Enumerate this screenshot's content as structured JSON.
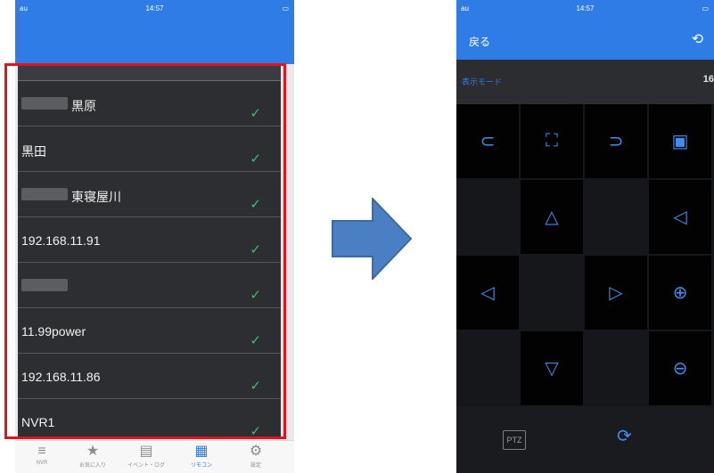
{
  "status_bar": {
    "carrier": "au",
    "time": "14:57"
  },
  "device_list": {
    "items": [
      {
        "name": "黒原",
        "blurred_prefix": true
      },
      {
        "name": "黒田",
        "blurred_prefix": false
      },
      {
        "name": "東寝屋川",
        "blurred_prefix": true
      },
      {
        "name": "192.168.11.91",
        "blurred_prefix": false
      },
      {
        "name": "",
        "blurred_prefix": true
      },
      {
        "name": "11.99power",
        "blurred_prefix": false
      },
      {
        "name": "192.168.11.86",
        "blurred_prefix": false
      },
      {
        "name": "NVR1",
        "blurred_prefix": false
      }
    ]
  },
  "tab_bar": {
    "tabs": [
      {
        "label": "NVR",
        "icon": "menu-icon"
      },
      {
        "label": "お気に入り",
        "icon": "star-icon"
      },
      {
        "label": "イベント・ログ",
        "icon": "chat-icon"
      },
      {
        "label": "リモコン",
        "icon": "grid-icon"
      },
      {
        "label": "設定",
        "icon": "gear-icon"
      }
    ],
    "active_tab": "リモコン"
  },
  "remote": {
    "back_label": "戻る",
    "mode_label": "表示モード",
    "mode_value": "16",
    "ptz_label": "PTZ"
  },
  "colors": {
    "accent": "#2f7ce6",
    "highlight": "#e3121d",
    "check": "#33c26a"
  }
}
